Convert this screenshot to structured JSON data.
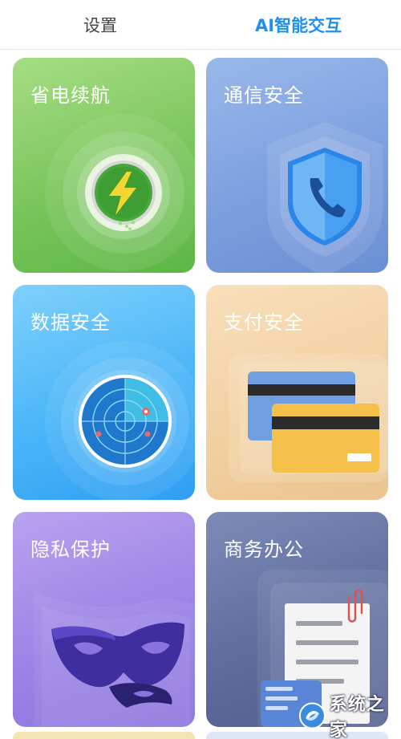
{
  "tabs": [
    {
      "label": "设置",
      "active": false
    },
    {
      "label": "AI智能交互",
      "active": true
    }
  ],
  "cards": {
    "power": {
      "title": "省电续航",
      "icon": "battery-bolt-icon"
    },
    "comm": {
      "title": "通信安全",
      "icon": "shield-phone-icon"
    },
    "data": {
      "title": "数据安全",
      "icon": "radar-icon"
    },
    "pay": {
      "title": "支付安全",
      "icon": "credit-card-icon"
    },
    "privacy": {
      "title": "隐私保护",
      "icon": "mask-icon"
    },
    "office": {
      "title": "商务办公",
      "icon": "document-icon"
    }
  },
  "watermark": {
    "text": "系统之家"
  },
  "colors": {
    "accent": "#1f8ff0",
    "inactive_tab": "#444444"
  }
}
